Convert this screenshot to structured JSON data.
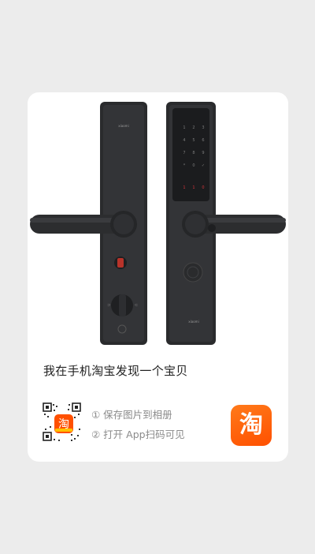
{
  "share_card": {
    "caption": "我在手机淘宝发现一个宝贝",
    "step1": "① 保存图片到相册",
    "step2": "② 打开 App扫码可见",
    "app_logo_text": "淘",
    "product_brand": "xiaomi",
    "product_image_icon": "smart-door-lock",
    "brand_color": "#ff5000"
  }
}
